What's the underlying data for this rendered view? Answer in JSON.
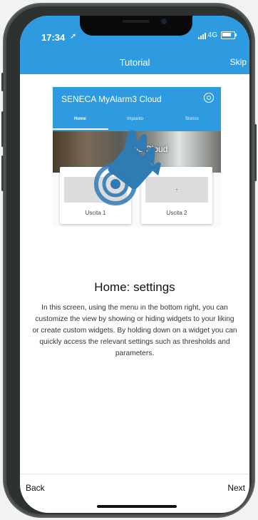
{
  "status_bar": {
    "time": "17:34",
    "network": "4G"
  },
  "nav": {
    "title": "Tutorial",
    "skip_label": "Skip"
  },
  "preview": {
    "app_title": "SENECA MyAlarm3 Cloud",
    "tabs": [
      "Home",
      "Impianto",
      "Storico"
    ],
    "banner_text": "m3 Cloud",
    "cards": [
      {
        "value": "-",
        "label": "Uscita 1"
      },
      {
        "value": "-",
        "label": "Uscita 2"
      }
    ]
  },
  "content": {
    "title": "Home: settings",
    "body": "In this screen, using the menu in the bottom right, you can customize the view by showing or hiding widgets to your liking or create custom widgets. By holding down on a widget you can quickly access the relevant settings such as thresholds and parameters."
  },
  "footer": {
    "back_label": "Back",
    "next_label": "Next"
  },
  "colors": {
    "accent": "#2e9be0",
    "hand": "#2f7bb4"
  },
  "icons": [
    "location-arrow-icon",
    "signal-icon",
    "battery-icon",
    "gear-icon",
    "tap-hand-icon"
  ]
}
